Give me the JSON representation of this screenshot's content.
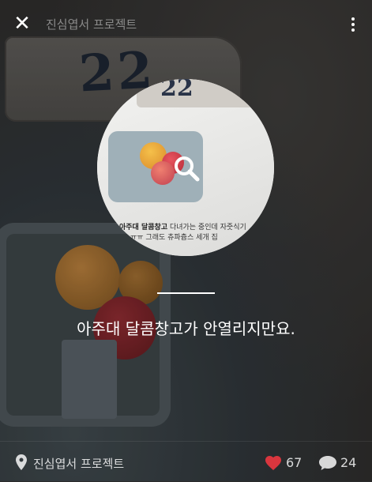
{
  "header": {
    "close_icon": "close-icon",
    "title": "진심엽서 프로젝트",
    "more_icon": "more-vertical-icon"
  },
  "photo": {
    "plate_number": "22"
  },
  "preview": {
    "plate_number": "22",
    "text_line_1_bold": "아주대 달콤창고",
    "text_line_1": " 다녀가는 중인데 자줏식기 ",
    "text_line_2": "요. ㅠㅠ 그래도 츄파츕스 세개 집",
    "zoom_icon": "search-icon"
  },
  "caption": {
    "text": "아주대 달콤창고가 안열리지만요."
  },
  "footer": {
    "location_icon": "location-pin-icon",
    "location": "진심엽서 프로젝트",
    "like_icon": "heart-icon",
    "likes": "67",
    "comment_icon": "comment-icon",
    "comments": "24"
  },
  "colors": {
    "heart": "#d9363e",
    "overlay_text": "#ffffff"
  }
}
